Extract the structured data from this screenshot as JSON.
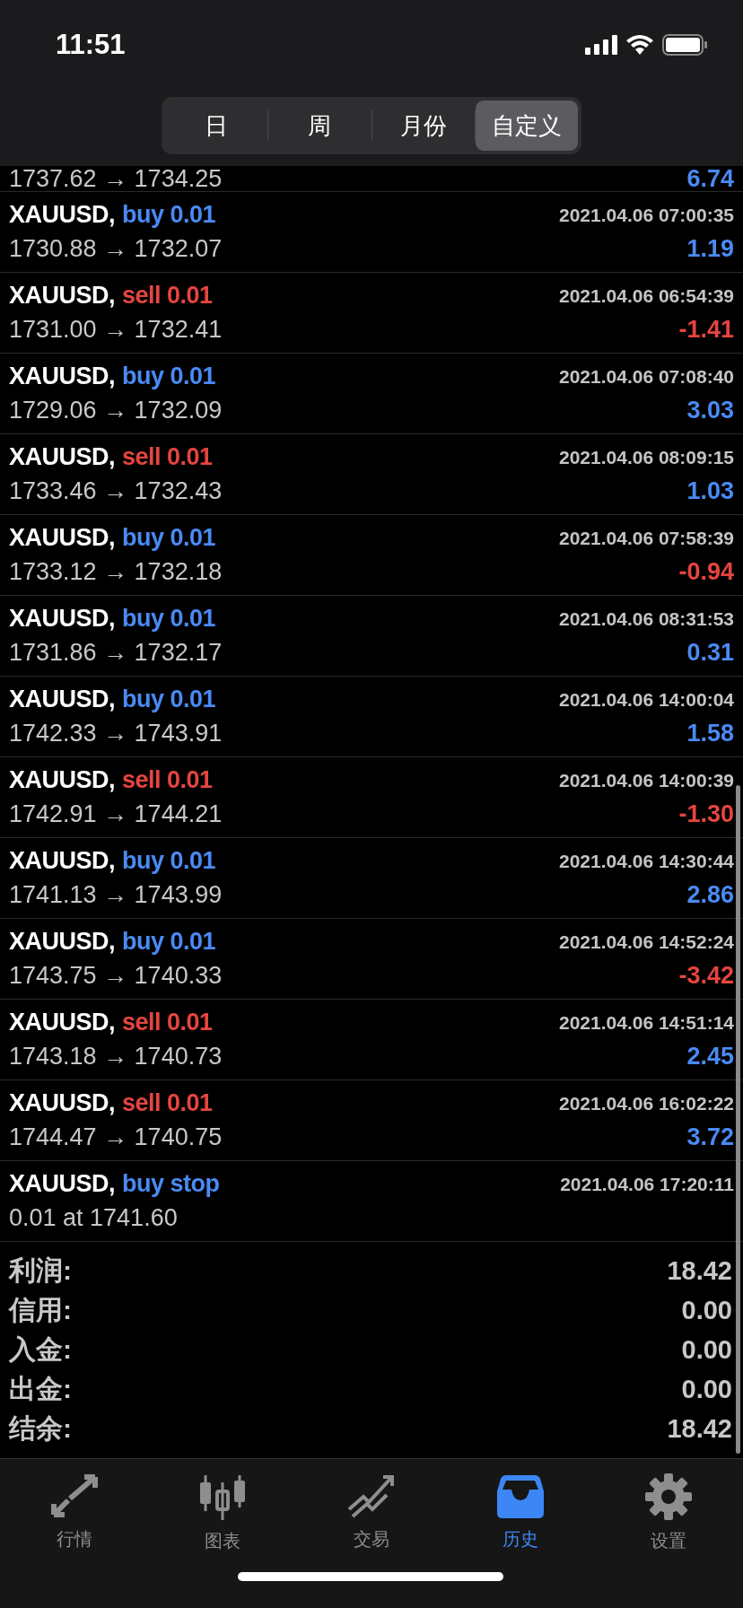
{
  "status_bar": {
    "time": "11:51"
  },
  "period_tabs": [
    {
      "label": "日",
      "selected": false
    },
    {
      "label": "周",
      "selected": false
    },
    {
      "label": "月份",
      "selected": false
    },
    {
      "label": "自定义",
      "selected": true
    }
  ],
  "partial_row": {
    "prices": "1737.62 → 1734.25",
    "profit": {
      "text": "6.74",
      "color": "#4a8af4"
    }
  },
  "rows": [
    {
      "kind": "deal",
      "symbol": "XAUUSD,",
      "action": {
        "text": "buy 0.01",
        "color": "#4a8af4"
      },
      "time": "2021.04.06 07:00:35",
      "prices": "1730.88 → 1732.07",
      "profit": {
        "text": "1.19",
        "color": "#4a8af4"
      }
    },
    {
      "kind": "deal",
      "symbol": "XAUUSD,",
      "action": {
        "text": "sell 0.01",
        "color": "#e5453f"
      },
      "time": "2021.04.06 06:54:39",
      "prices": "1731.00 → 1732.41",
      "profit": {
        "text": "-1.41",
        "color": "#e5453f"
      }
    },
    {
      "kind": "deal",
      "symbol": "XAUUSD,",
      "action": {
        "text": "buy 0.01",
        "color": "#4a8af4"
      },
      "time": "2021.04.06 07:08:40",
      "prices": "1729.06 → 1732.09",
      "profit": {
        "text": "3.03",
        "color": "#4a8af4"
      }
    },
    {
      "kind": "deal",
      "symbol": "XAUUSD,",
      "action": {
        "text": "sell 0.01",
        "color": "#e5453f"
      },
      "time": "2021.04.06 08:09:15",
      "prices": "1733.46 → 1732.43",
      "profit": {
        "text": "1.03",
        "color": "#4a8af4"
      }
    },
    {
      "kind": "deal",
      "symbol": "XAUUSD,",
      "action": {
        "text": "buy 0.01",
        "color": "#4a8af4"
      },
      "time": "2021.04.06 07:58:39",
      "prices": "1733.12 → 1732.18",
      "profit": {
        "text": "-0.94",
        "color": "#e5453f"
      }
    },
    {
      "kind": "deal",
      "symbol": "XAUUSD,",
      "action": {
        "text": "buy 0.01",
        "color": "#4a8af4"
      },
      "time": "2021.04.06 08:31:53",
      "prices": "1731.86 → 1732.17",
      "profit": {
        "text": "0.31",
        "color": "#4a8af4"
      }
    },
    {
      "kind": "deal",
      "symbol": "XAUUSD,",
      "action": {
        "text": "buy 0.01",
        "color": "#4a8af4"
      },
      "time": "2021.04.06 14:00:04",
      "prices": "1742.33 → 1743.91",
      "profit": {
        "text": "1.58",
        "color": "#4a8af4"
      }
    },
    {
      "kind": "deal",
      "symbol": "XAUUSD,",
      "action": {
        "text": "sell 0.01",
        "color": "#e5453f"
      },
      "time": "2021.04.06 14:00:39",
      "prices": "1742.91 → 1744.21",
      "profit": {
        "text": "-1.30",
        "color": "#e5453f"
      }
    },
    {
      "kind": "deal",
      "symbol": "XAUUSD,",
      "action": {
        "text": "buy 0.01",
        "color": "#4a8af4"
      },
      "time": "2021.04.06 14:30:44",
      "prices": "1741.13 → 1743.99",
      "profit": {
        "text": "2.86",
        "color": "#4a8af4"
      }
    },
    {
      "kind": "deal",
      "symbol": "XAUUSD,",
      "action": {
        "text": "buy 0.01",
        "color": "#4a8af4"
      },
      "time": "2021.04.06 14:52:24",
      "prices": "1743.75 → 1740.33",
      "profit": {
        "text": "-3.42",
        "color": "#e5453f"
      }
    },
    {
      "kind": "deal",
      "symbol": "XAUUSD,",
      "action": {
        "text": "sell 0.01",
        "color": "#e5453f"
      },
      "time": "2021.04.06 14:51:14",
      "prices": "1743.18 → 1740.73",
      "profit": {
        "text": "2.45",
        "color": "#4a8af4"
      }
    },
    {
      "kind": "deal",
      "symbol": "XAUUSD,",
      "action": {
        "text": "sell 0.01",
        "color": "#e5453f"
      },
      "time": "2021.04.06 16:02:22",
      "prices": "1744.47 → 1740.75",
      "profit": {
        "text": "3.72",
        "color": "#4a8af4"
      }
    },
    {
      "kind": "order",
      "symbol": "XAUUSD,",
      "action": {
        "text": "buy stop",
        "color": "#4a8af4"
      },
      "time": "2021.04.06 17:20:11",
      "prices": "0.01 at 1741.60"
    }
  ],
  "summary": [
    {
      "label": "利润:",
      "value": "18.42"
    },
    {
      "label": "信用:",
      "value": "0.00"
    },
    {
      "label": "入金:",
      "value": "0.00"
    },
    {
      "label": "出金:",
      "value": "0.00"
    },
    {
      "label": "结余:",
      "value": "18.42"
    }
  ],
  "tab_bar": [
    {
      "kind": "quotes",
      "label": "行情",
      "selected": false
    },
    {
      "kind": "chart",
      "label": "图表",
      "selected": false
    },
    {
      "kind": "trade",
      "label": "交易",
      "selected": false
    },
    {
      "kind": "history",
      "label": "历史",
      "selected": true
    },
    {
      "kind": "settings",
      "label": "设置",
      "selected": false
    }
  ]
}
